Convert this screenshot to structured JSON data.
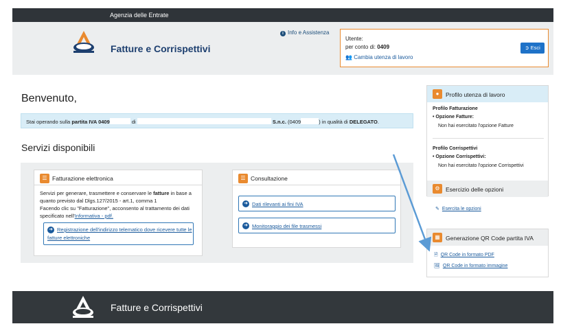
{
  "topbar": {
    "agency": "Agenzia delle Entrate"
  },
  "header": {
    "brand": "Fatture e Corrispettivi",
    "info_link": "Info e Assistenza",
    "user": {
      "utente_label": "Utente:",
      "conto_label": "per conto di:",
      "conto_value": "0409",
      "change_link": "Cambia utenza di lavoro",
      "logout_button": "Esci"
    }
  },
  "main": {
    "welcome": "Benvenuto,",
    "infobar": {
      "prefix": "Stai operando sulla",
      "piva_label": "partita IVA 0409",
      "di": "di",
      "company_suffix": "S.n.c.",
      "code_prefix": "(0409",
      "code_suffix": ")",
      "role_prefix": "in qualità di",
      "role": "DELEGATO",
      "end": "."
    },
    "services_title": "Servizi disponibili",
    "fatturazione": {
      "title": "Fatturazione elettronica",
      "p1_before": "Servizi per generare, trasmettere e conservare le",
      "p1_bold": "fatture",
      "p1_after": "in base a",
      "p2": "quanto previsto dal Dlgs.127/2015 - art.1, comma 1",
      "p3": "Facendo clic su \"Fatturazione\", acconsento al trattamento dei dati",
      "p4_before": "specificato nell'",
      "p4_link": "Informativa - pdf.",
      "link_line1": "Registrazione dell'indirizzo telematico dove ricevere tutte le",
      "link_line2": "fatture elettroniche"
    },
    "consultazione": {
      "title": "Consultazione",
      "link1": "Dati rilevanti ai fini IVA",
      "link2": "Monitoraggio dei file trasmessi"
    }
  },
  "sidebar": {
    "profilo": {
      "title": "Profilo utenza di lavoro",
      "fatt_heading": "Profilo Fatturazione",
      "fatt_option_label": "Opzione Fatture:",
      "fatt_option_text": "Non hai esercitato l'opzione Fatture",
      "corr_heading": "Profilo Corrispettivi",
      "corr_option_label": "Opzione Corrispettivi:",
      "corr_option_text": "Non hai esercitato l'opzione Corrispettivi"
    },
    "esercizio": {
      "title": "Esercizio delle opzioni",
      "link": "Esercita le opzioni"
    },
    "qr": {
      "title": "Generazione QR Code partita IVA",
      "link_pdf": "QR Code in formato PDF",
      "link_img": "QR Code in formato immagine"
    }
  },
  "footer": {
    "brand": "Fatture e Corrispettivi"
  }
}
